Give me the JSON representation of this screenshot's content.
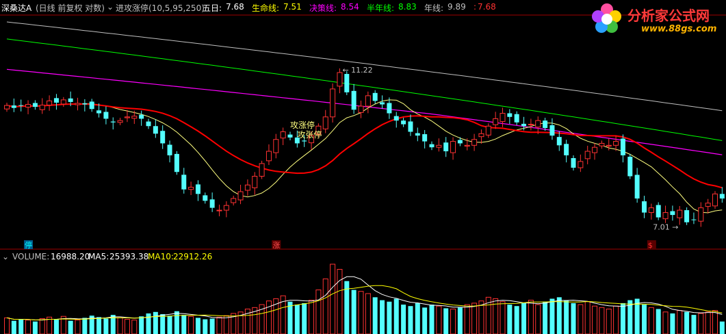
{
  "header": {
    "app_name": "深桑达A",
    "period": "(日线 前复权 对数)",
    "indicator": "进攻涨停(10,5,95,250)",
    "lines": [
      {
        "label": "五日:",
        "value": "7.68",
        "color": "#ffffff"
      },
      {
        "label": "生命线:",
        "value": "7.51",
        "color": "#ffff00"
      },
      {
        "label": "决策线:",
        "value": "8.54",
        "color": "#ff00ff"
      },
      {
        "label": "半年线:",
        "value": "8.83",
        "color": "#00ff00"
      },
      {
        "label": "年线:",
        "value": "9.89",
        "color": "#c0c0c0"
      },
      {
        "label": ":",
        "value": "7.68",
        "color": "#ff3232"
      }
    ]
  },
  "volume_header": {
    "label": "VOLUME:",
    "value": "16988.20",
    "ma5_label": "MA5:",
    "ma5": "25393.38",
    "ma10_label": "MA10:",
    "ma10": "22912.26"
  },
  "logo": {
    "title": "分析家公式网",
    "url": "www.88gs.com"
  },
  "chart_data": {
    "type": "candlestick",
    "price_range": [
      6.6,
      12.8
    ],
    "max_label": "11.22",
    "min_label": "7.01",
    "signal_labels": [
      "攻涨停",
      "攻张停"
    ],
    "bottom_tags": [
      {
        "text": "停",
        "color": "#00ffff",
        "index": 3
      },
      {
        "text": "涨",
        "color": "#ff5050",
        "index": 38
      },
      {
        "text": "$",
        "color": "#ff3232",
        "index": 91
      }
    ],
    "colors": {
      "up": "#ff3232",
      "down": "#54ffff",
      "ma5": "#ff0000",
      "life": "#ffff80",
      "decision": "#ff00ff",
      "half": "#00ff00",
      "year": "#c0c0c0"
    },
    "closes": [
      9.92,
      9.85,
      9.91,
      9.95,
      9.88,
      9.93,
      10.05,
      10.0,
      10.08,
      10.02,
      9.98,
      9.95,
      9.82,
      9.7,
      9.55,
      9.45,
      9.5,
      9.6,
      9.62,
      9.55,
      9.35,
      9.15,
      8.9,
      8.6,
      8.2,
      7.8,
      7.85,
      7.7,
      7.55,
      7.4,
      7.35,
      7.45,
      7.6,
      7.75,
      7.9,
      8.1,
      8.4,
      8.7,
      9.0,
      9.2,
      9.05,
      8.9,
      8.95,
      9.1,
      9.35,
      9.6,
      10.4,
      10.9,
      10.3,
      9.8,
      9.9,
      10.2,
      10.05,
      9.95,
      9.7,
      9.5,
      9.4,
      9.2,
      9.1,
      8.95,
      8.8,
      8.85,
      8.7,
      8.95,
      8.9,
      8.85,
      9.0,
      9.15,
      9.35,
      9.55,
      9.7,
      9.6,
      9.45,
      9.35,
      9.4,
      9.5,
      9.3,
      9.1,
      8.85,
      8.6,
      8.3,
      8.45,
      8.7,
      8.8,
      8.9,
      8.85,
      8.95,
      8.6,
      8.1,
      7.6,
      7.3,
      7.4,
      7.2,
      7.3,
      7.25,
      7.35,
      7.1,
      7.15,
      7.4,
      7.5,
      7.7,
      7.6
    ],
    "volumes": [
      22,
      18,
      20,
      19,
      17,
      21,
      23,
      20,
      24,
      18,
      19,
      22,
      25,
      23,
      21,
      26,
      22,
      20,
      19,
      24,
      28,
      30,
      27,
      25,
      31,
      26,
      24,
      22,
      20,
      21,
      23,
      25,
      28,
      30,
      34,
      36,
      40,
      45,
      48,
      52,
      44,
      40,
      42,
      46,
      60,
      75,
      95,
      88,
      72,
      60,
      58,
      55,
      50,
      46,
      44,
      48,
      40,
      38,
      42,
      36,
      40,
      38,
      35,
      34,
      36,
      40,
      42,
      45,
      50,
      48,
      44,
      40,
      38,
      42,
      46,
      40,
      44,
      48,
      50,
      46,
      42,
      40,
      44,
      38,
      36,
      34,
      38,
      42,
      46,
      48,
      40,
      36,
      34,
      30,
      28,
      32,
      30,
      26,
      28,
      30,
      32,
      17
    ]
  }
}
